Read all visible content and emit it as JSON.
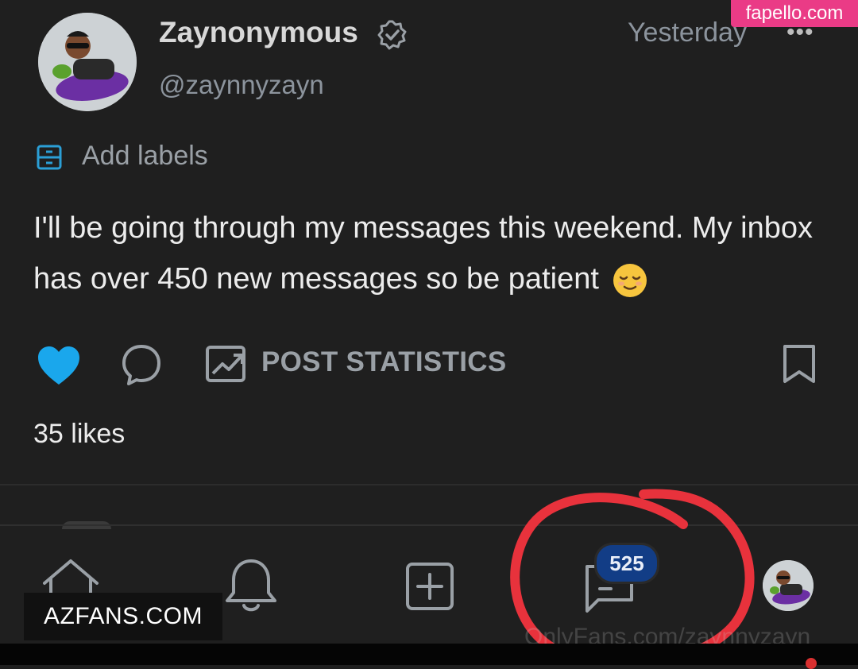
{
  "watermarks": {
    "top_right": "fapello.com",
    "bottom_left": "AZFANS.COM",
    "bottom_right": "OnlyFans.com/zaynnyzayn"
  },
  "post": {
    "author_name": "Zaynonymous",
    "handle": "@zaynnyzayn",
    "timestamp": "Yesterday",
    "more_icon": "•••",
    "add_labels": "Add labels",
    "body": "I'll be going through my messages this weekend. My inbox has over 450 new messages so be patient",
    "emoji": "relieved-face",
    "post_statistics_label": "POST STATISTICS",
    "likes": "35 likes",
    "liked": true
  },
  "nav": {
    "messages_badge": "525"
  },
  "colors": {
    "background": "#1f1f1f",
    "like": "#00aff0",
    "badge": "#123d86",
    "annotation": "#e8323c",
    "watermark_pink": "#ea3b86"
  }
}
